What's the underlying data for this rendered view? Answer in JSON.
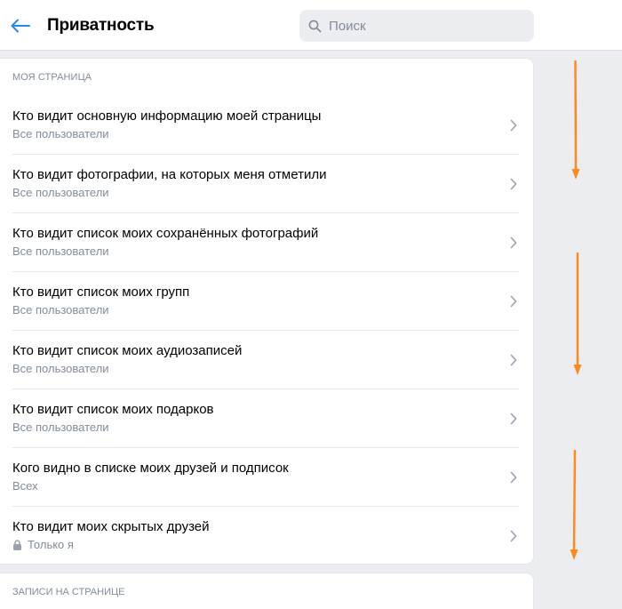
{
  "header": {
    "title": "Приватность",
    "search_placeholder": "Поиск"
  },
  "section": {
    "title": "Моя страница",
    "items": [
      {
        "title": "Кто видит основную информацию моей страницы",
        "value": "Все пользователи"
      },
      {
        "title": "Кто видит фотографии, на которых меня отметили",
        "value": "Все пользователи"
      },
      {
        "title": "Кто видит список моих сохранённых фотографий",
        "value": "Все пользователи"
      },
      {
        "title": "Кто видит список моих групп",
        "value": "Все пользователи"
      },
      {
        "title": "Кто видит список моих аудиозаписей",
        "value": "Все пользователи"
      },
      {
        "title": "Кто видит список моих подарков",
        "value": "Все пользователи"
      },
      {
        "title": "Кого видно в списке моих друзей и подписок",
        "value": "Всех"
      },
      {
        "title": "Кто видит моих скрытых друзей",
        "value": "Только я"
      }
    ]
  },
  "section2": {
    "title": "Записи на странице"
  },
  "colors": {
    "accent": "#2688eb",
    "annotation": "#ff8a1f",
    "secondary_text": "#818c99"
  }
}
